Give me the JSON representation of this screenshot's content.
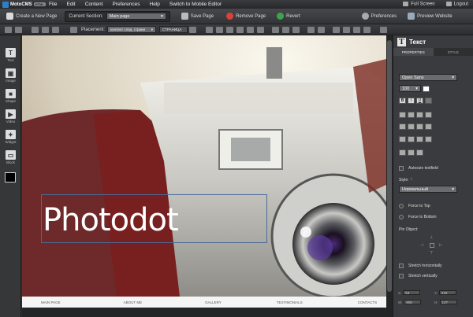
{
  "menubar": {
    "logo": "MotoCMS",
    "logo_tag": "HTML",
    "items": [
      "File",
      "Edit",
      "Content",
      "Preferences",
      "Help",
      "Switch to Mobile Editor"
    ],
    "full_screen": "Full Screen",
    "logout": "Logout"
  },
  "toolbar": {
    "create_page": "Create a New Page",
    "current_section_label": "Current Section:",
    "current_section_value": "Main page",
    "save_page": "Save Page",
    "remove_page": "Remove Page",
    "revert": "Revert",
    "preferences": "Preferences",
    "preview": "Preview Website"
  },
  "toolbar2": {
    "placement_label": "Placement:",
    "placement_value": "контент след. страни",
    "page_label": "СТРАНИЦА"
  },
  "leftbar": {
    "tools": [
      {
        "label": "Text",
        "glyph": "T"
      },
      {
        "label": "Image",
        "glyph": "▣"
      },
      {
        "label": "Shape",
        "glyph": "■"
      },
      {
        "label": "Video",
        "glyph": "▶"
      },
      {
        "label": "Widget",
        "glyph": "✦"
      },
      {
        "label": "Block",
        "glyph": "▭"
      }
    ],
    "color": "#000000"
  },
  "canvas": {
    "headline": "Photodot",
    "nav": [
      "MAIN PAGE",
      "ABOUT ME",
      "GALLERY",
      "TESTIMONIALS",
      "CONTACTS"
    ]
  },
  "rightpanel": {
    "title": "Текст",
    "tabs": [
      "PROPERTIES",
      "STYLE"
    ],
    "font_family": "Open Sans",
    "font_size": "100",
    "autosize": "Autosize textfield",
    "style_label": "Style:",
    "style_value": "Нормальный",
    "force_top": "Force to Top",
    "force_bottom": "Force to Bottom",
    "pin_object": "Pin Object:",
    "stretch_h": "Stretch horizontally",
    "stretch_v": "Stretch vertically",
    "x": "53",
    "y": "432",
    "w": "605",
    "h": "127"
  }
}
